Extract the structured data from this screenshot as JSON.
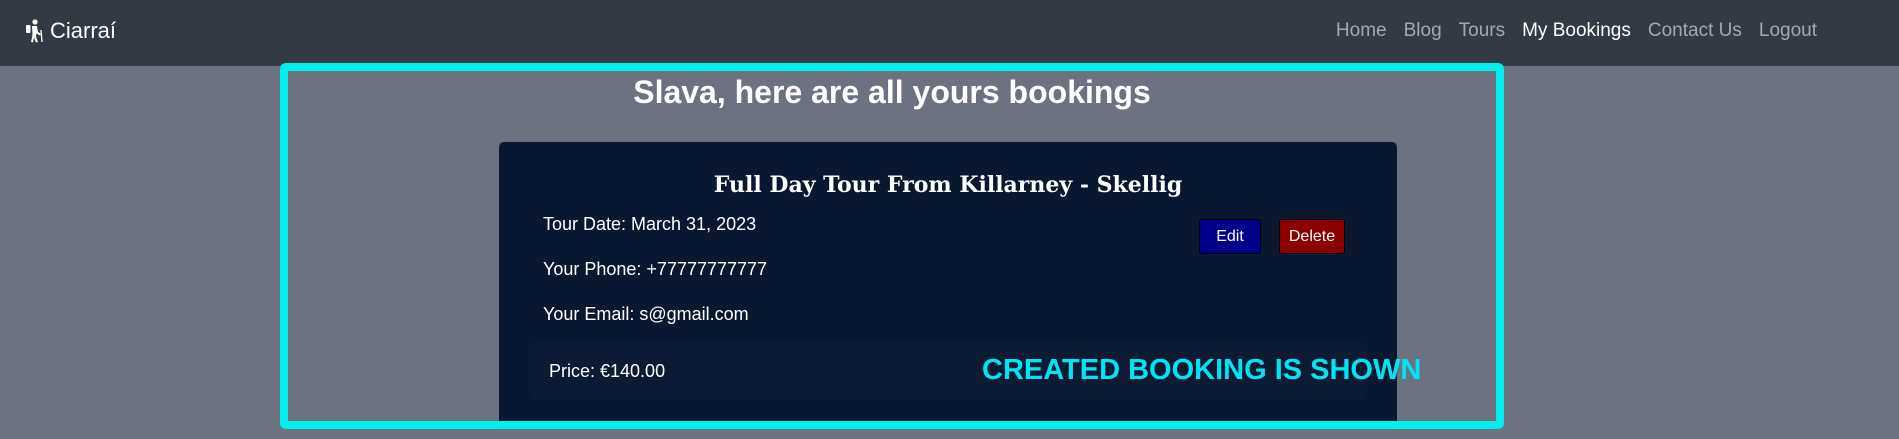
{
  "navbar": {
    "brand": "Ciarraí",
    "brand_icon": "hiker-icon",
    "links": [
      {
        "label": "Home",
        "active": false
      },
      {
        "label": "Blog",
        "active": false
      },
      {
        "label": "Tours",
        "active": false
      },
      {
        "label": "My Bookings",
        "active": true
      },
      {
        "label": "Contact Us",
        "active": false
      },
      {
        "label": "Logout",
        "active": false
      }
    ]
  },
  "main": {
    "title": "Slava, here are all yours bookings"
  },
  "booking": {
    "tour_name": "Full Day Tour From Killarney - Skellig",
    "tour_date": "Tour Date: March 31, 2023",
    "phone": "Your Phone: +77777777777",
    "email": "Your Email: s@gmail.com",
    "price": "Price: €140.00",
    "edit_label": "Edit",
    "delete_label": "Delete"
  },
  "annotation": {
    "text": "CREATED BOOKING IS SHOWN",
    "color": "#00e5f2"
  },
  "colors": {
    "navbar_bg": "#343a43",
    "page_bg": "#6c7280",
    "card_bg": "#0a1730",
    "highlight": "#00f0f0",
    "edit_button": "#00008b",
    "delete_button": "#8b0000"
  }
}
